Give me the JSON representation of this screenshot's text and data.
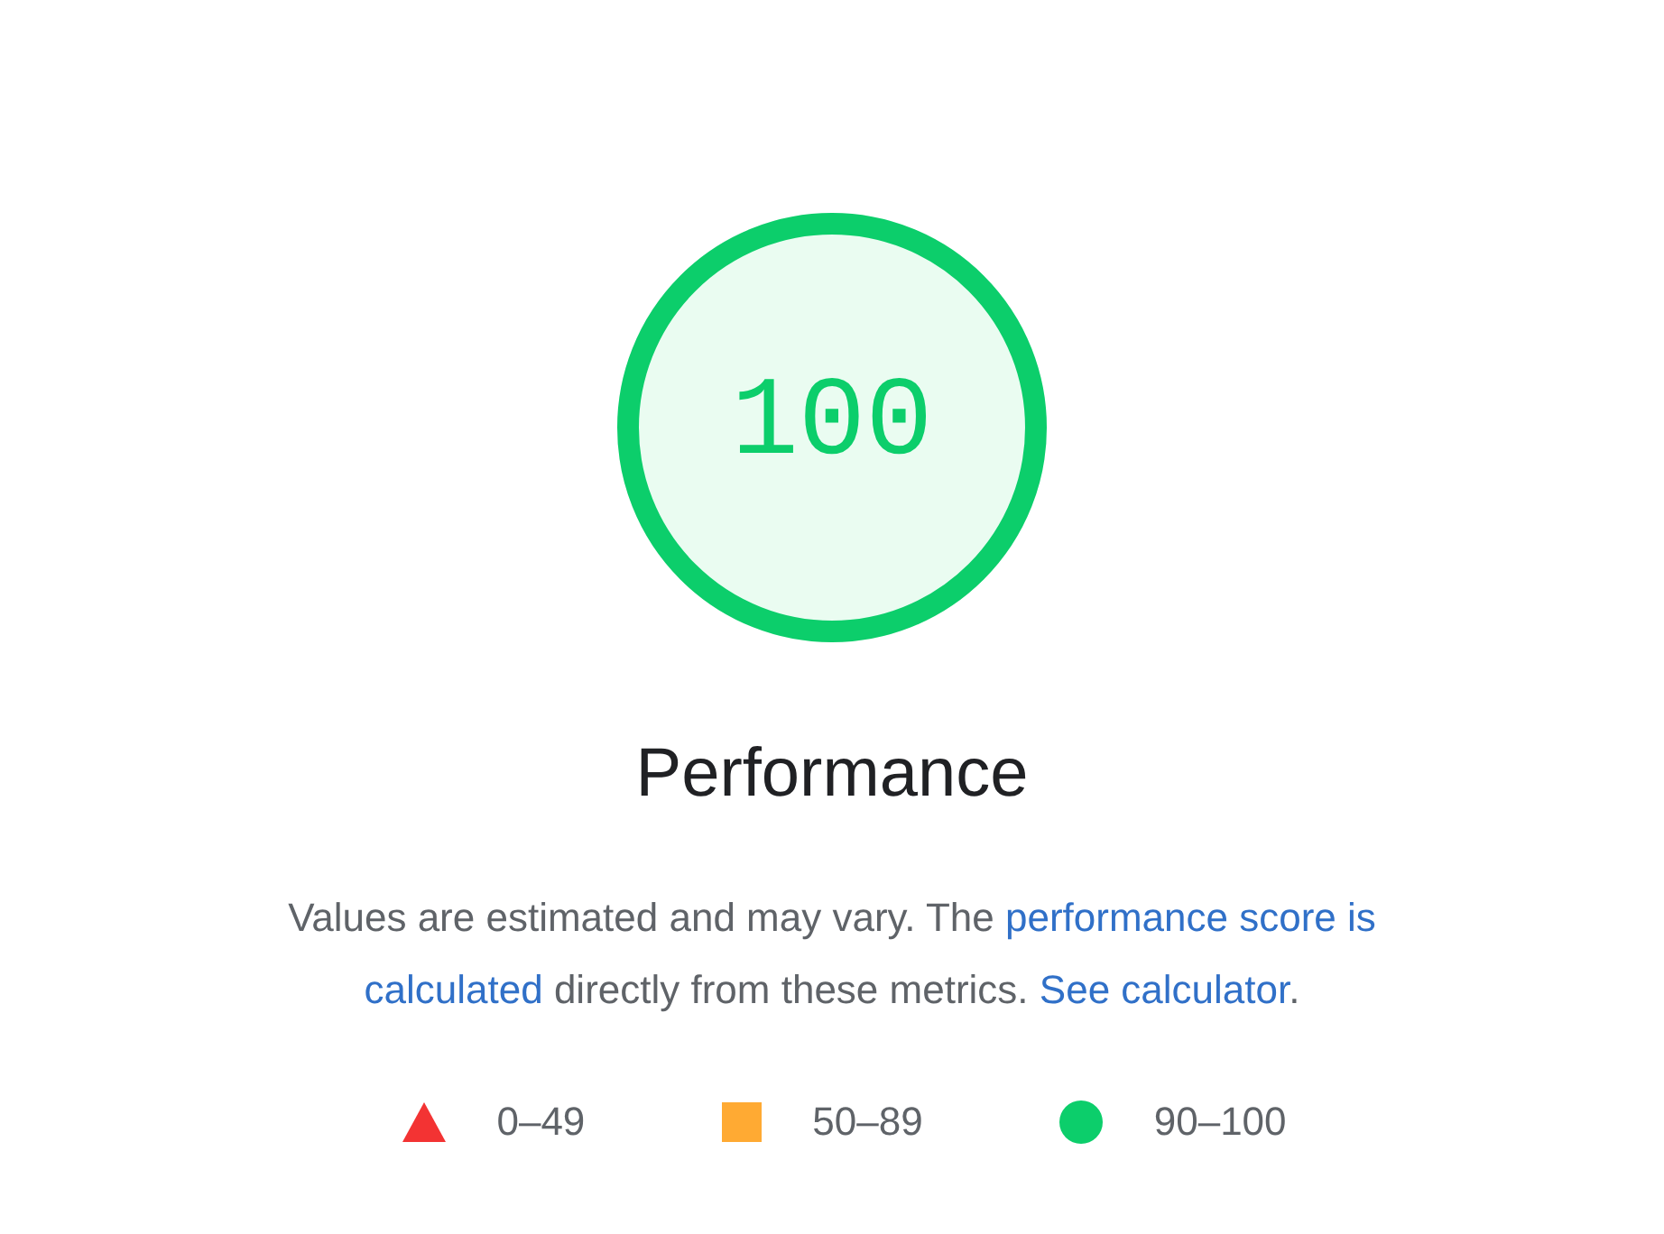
{
  "gauge": {
    "score": "100",
    "level": 1
  },
  "title": "Performance",
  "description": [
    {
      "kind": "text",
      "text": "Values are estimated and may vary. The "
    },
    {
      "kind": "link",
      "text": "performance score is"
    },
    {
      "kind": "break"
    },
    {
      "kind": "link",
      "text": "calculated"
    },
    {
      "kind": "text",
      "text": " directly from these metrics. "
    },
    {
      "kind": "link",
      "text": "See calculator"
    },
    {
      "kind": "text",
      "text": "."
    }
  ],
  "legend": [
    {
      "kind": "triangle",
      "color": "#f33333",
      "range": "0–49"
    },
    {
      "kind": "square",
      "color": "#ffaa33",
      "range": "50–89"
    },
    {
      "kind": "circle",
      "color": "#0cce6b",
      "range": "90–100"
    }
  ]
}
